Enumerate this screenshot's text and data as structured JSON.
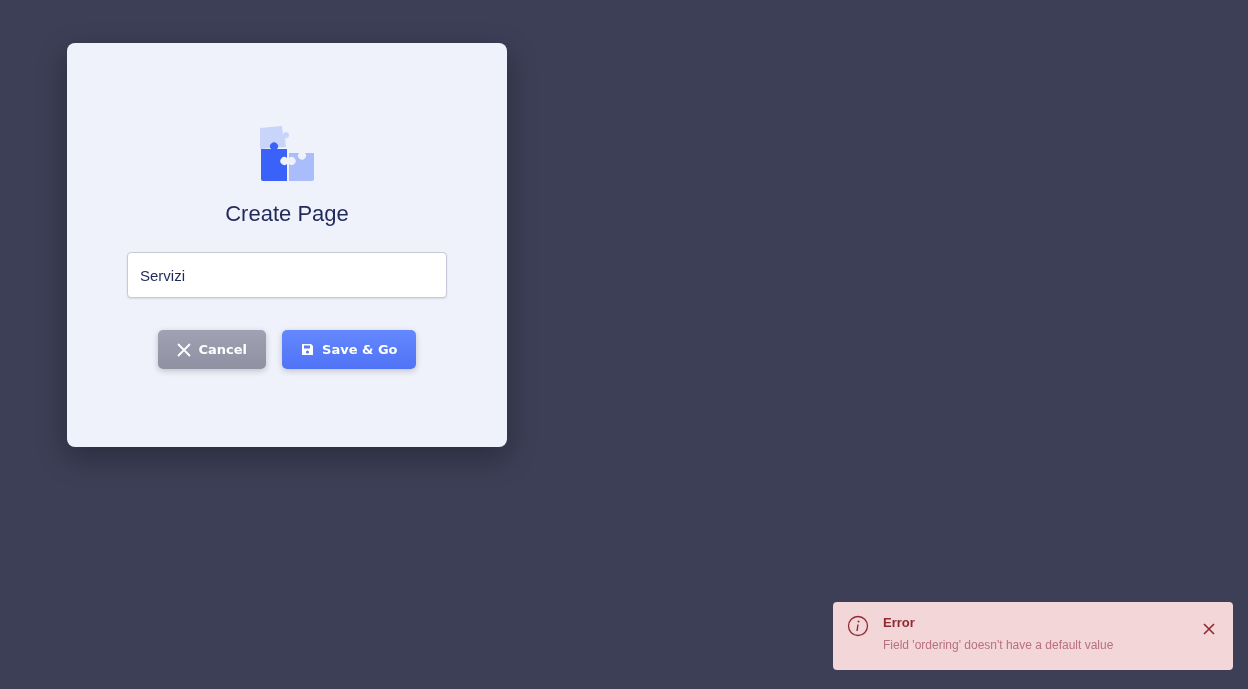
{
  "dialog": {
    "title": "Create Page",
    "name_field": {
      "value": "Servizi"
    },
    "buttons": [
      {
        "kind": "cancel",
        "label": "Cancel"
      },
      {
        "kind": "save",
        "label": "Save & Go"
      }
    ]
  },
  "toast": {
    "kind": "error",
    "title": "Error",
    "message": "Field 'ordering' doesn't have a default value"
  }
}
